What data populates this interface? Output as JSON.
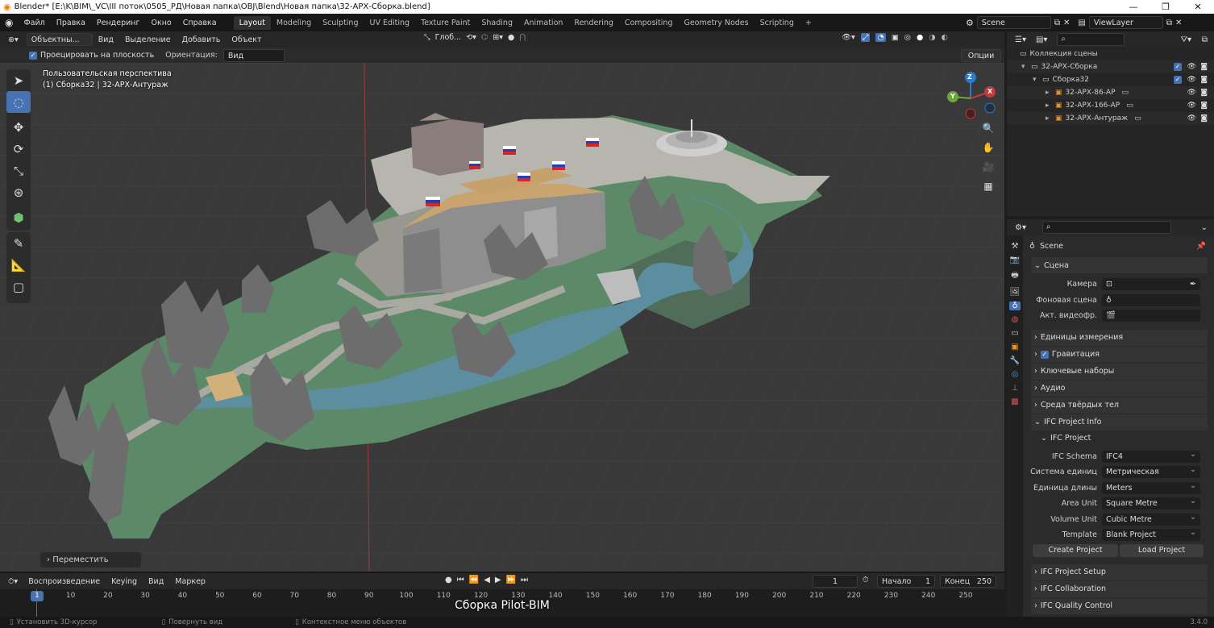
{
  "window": {
    "title": "Blender* [E:\\K\\BIM\\_VC\\III поток\\0505_РД\\Новая папка\\OBJ\\Blend\\Новая папка\\32-АРХ-Сборка.blend]",
    "minimize": "—",
    "maximize": "❐",
    "close": "✕"
  },
  "menu": [
    "Файл",
    "Правка",
    "Рендеринг",
    "Окно",
    "Справка"
  ],
  "workspaces": [
    "Layout",
    "Modeling",
    "Sculpting",
    "UV Editing",
    "Texture Paint",
    "Shading",
    "Animation",
    "Rendering",
    "Compositing",
    "Geometry Nodes",
    "Scripting"
  ],
  "workspace_add": "+",
  "scene_field": "Scene",
  "viewlayer_field": "ViewLayer",
  "viewport_header": {
    "mode": "Объектны...",
    "menus": [
      "Вид",
      "Выделение",
      "Добавить",
      "Объект"
    ],
    "orientation": "Глоб...",
    "options_label": "Опции"
  },
  "tool_settings": {
    "project_checkbox": "Проецировать на плоскость",
    "orientation_label": "Ориентация:",
    "orientation_value": "Вид"
  },
  "viewport": {
    "perspective_label": "Пользовательская перспектива",
    "object_label": "(1) Сборка32 | 32-АРХ-Антураж",
    "operator_panel": "Переместить",
    "gizmo": {
      "x": "X",
      "y": "Y",
      "z": "Z"
    },
    "accent": "#4772b3",
    "grass_color": "#5c8a68",
    "water_color": "#5c8ea0"
  },
  "outliner": {
    "root": "Коллекция сцены",
    "items": [
      {
        "label": "32-АРХ-Сборка",
        "level": 1
      },
      {
        "label": "Сборка32",
        "level": 2
      },
      {
        "label": "32-АРХ-86-АР",
        "level": 3
      },
      {
        "label": "32-АРХ-166-АР",
        "level": 3
      },
      {
        "label": "32-АРХ-Антураж",
        "level": 3
      }
    ]
  },
  "properties": {
    "context": "Scene",
    "scene_panel": "Сцена",
    "camera_label": "Камера",
    "bg_scene_label": "Фоновая сцена",
    "clip_label": "Акт. видеофр.",
    "panels": [
      "Единицы измерения",
      "Гравитация",
      "Ключевые наборы",
      "Аудио",
      "Среда твёрдых тел",
      "IFC Project Info"
    ],
    "ifc_subpanel": "IFC Project",
    "ifc_fields": [
      {
        "label": "IFC Schema",
        "value": "IFC4"
      },
      {
        "label": "Система единиц",
        "value": "Метрическая"
      },
      {
        "label": "Единица длины",
        "value": "Meters"
      },
      {
        "label": "Area Unit",
        "value": "Square Metre"
      },
      {
        "label": "Volume Unit",
        "value": "Cubic Metre"
      },
      {
        "label": "Template",
        "value": "Blank Project"
      }
    ],
    "create_project": "Create Project",
    "load_project": "Load Project",
    "lower_panels": [
      "IFC Project Setup",
      "IFC Collaboration",
      "IFC Quality Control"
    ]
  },
  "timeline": {
    "playback": "Воспроизведение",
    "keying": "Keying",
    "view": "Вид",
    "marker": "Маркер",
    "current_frame": "1",
    "start_label": "Начало",
    "start_value": "1",
    "end_label": "Конец",
    "end_value": "250",
    "ticks": [
      "1",
      "10",
      "20",
      "30",
      "40",
      "50",
      "60",
      "70",
      "80",
      "90",
      "100",
      "110",
      "120",
      "130",
      "140",
      "150",
      "160",
      "170",
      "180",
      "190",
      "200",
      "210",
      "220",
      "230",
      "240",
      "250"
    ],
    "overlay_caption": "Сборка Pilot-BIM"
  },
  "statusbar": {
    "left": "Установить 3D-курсор",
    "mid": "Повернуть вид",
    "right": "Контекстное меню объектов",
    "version": "3.4.0"
  }
}
